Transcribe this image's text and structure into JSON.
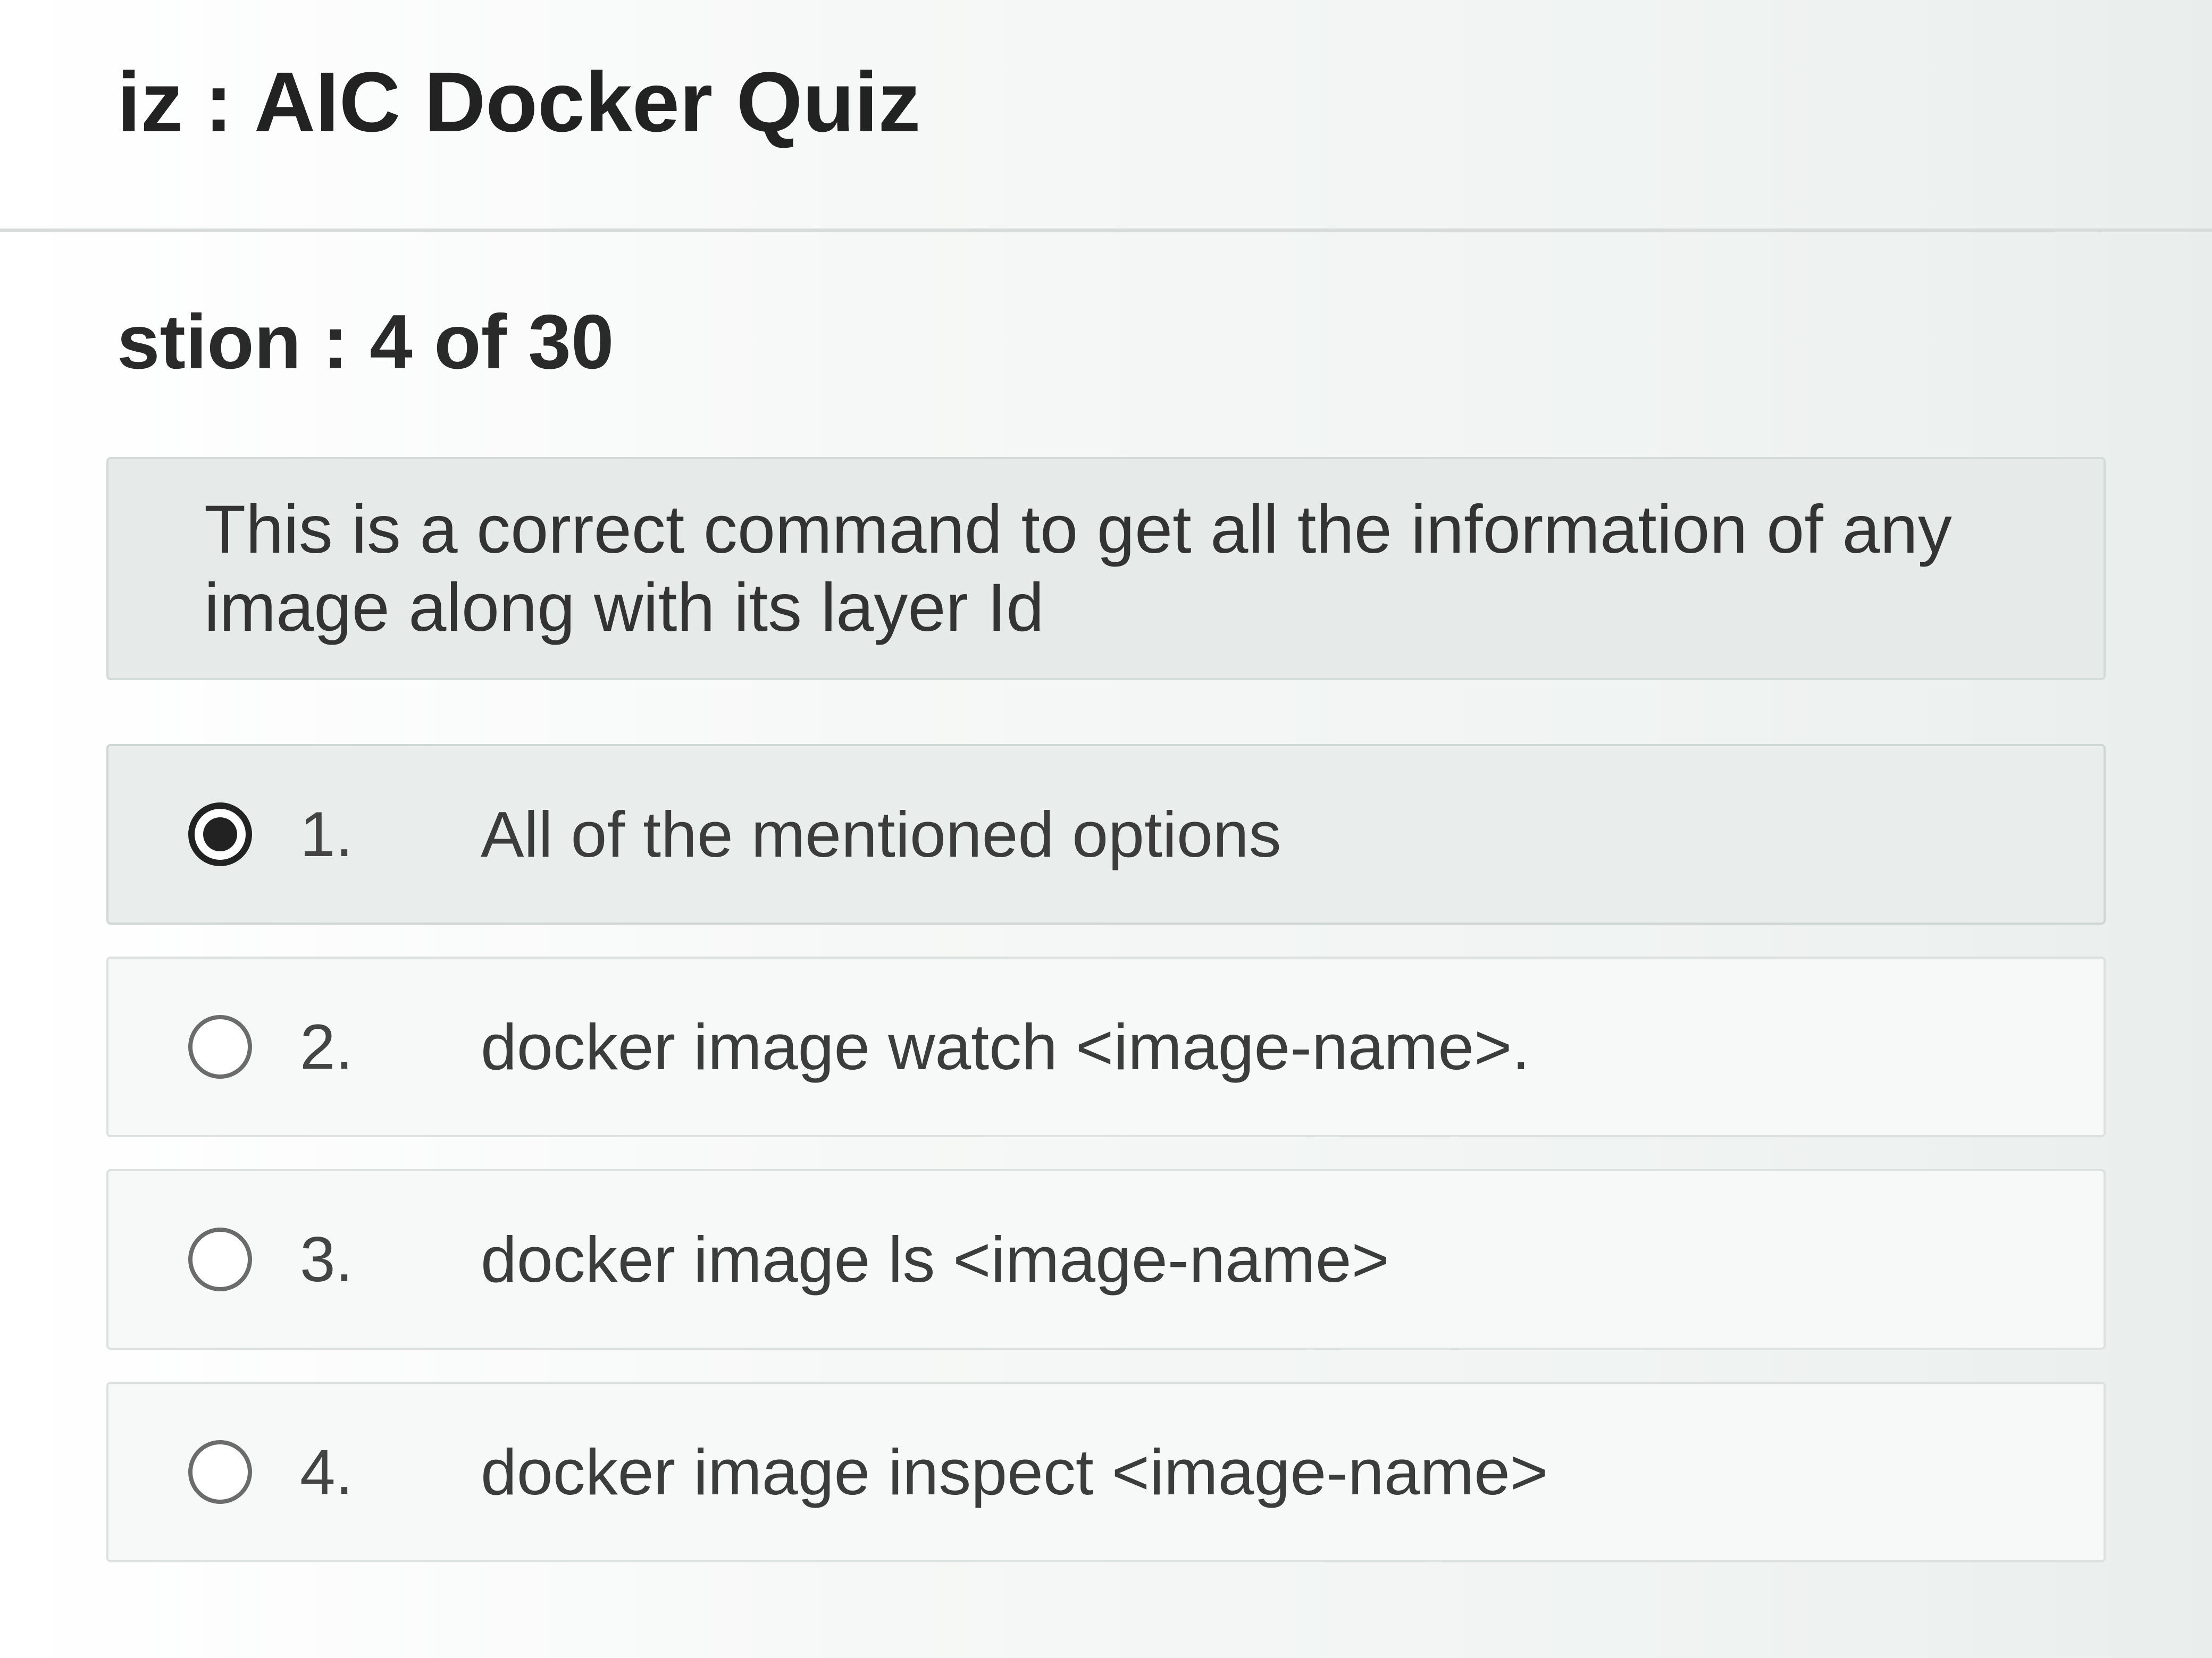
{
  "quiz": {
    "title_prefix": "iz",
    "title_separator": ":",
    "title": "AIC Docker Quiz"
  },
  "question_counter": "stion : 4 of 30",
  "question": {
    "text": "This is a correct command to get all the information of any image along with its layer Id"
  },
  "options": [
    {
      "number": "1.",
      "text": "All of the mentioned options",
      "selected": true
    },
    {
      "number": "2.",
      "text": "docker image watch <image-name>.",
      "selected": false
    },
    {
      "number": "3.",
      "text": "docker image ls <image-name>",
      "selected": false
    },
    {
      "number": "4.",
      "text": "docker image inspect <image-name>",
      "selected": false
    }
  ]
}
